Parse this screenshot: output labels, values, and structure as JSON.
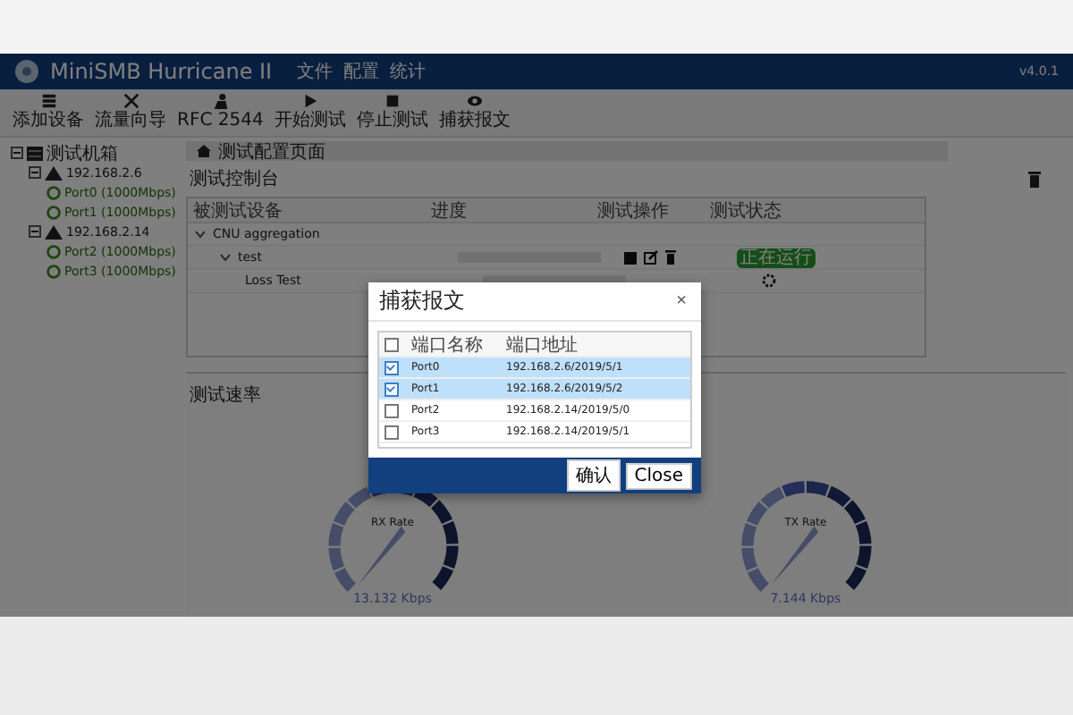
{
  "app": {
    "title": "MiniSMB Hurricane II",
    "version": "v4.0.1"
  },
  "menu": [
    "文件",
    "配置",
    "统计"
  ],
  "toolbar": [
    {
      "label": "添加设备",
      "kind": "add"
    },
    {
      "label": "流量向导",
      "kind": "wizard"
    },
    {
      "label": "RFC 2544",
      "kind": "rfc"
    },
    {
      "label": "开始测试",
      "kind": "start"
    },
    {
      "label": "停止测试",
      "kind": "stop"
    },
    {
      "label": "捕获报文",
      "kind": "capture"
    }
  ],
  "tree": [
    {
      "label": "测试机箱",
      "kind": "chassis",
      "expanded": true,
      "children": [
        {
          "label": "192.168.2.6",
          "kind": "host",
          "expanded": true,
          "children": [
            {
              "label": "Port0 (1000Mbps)",
              "kind": "port"
            },
            {
              "label": "Port1 (1000Mbps)",
              "kind": "port"
            }
          ]
        },
        {
          "label": "192.168.2.14",
          "kind": "host",
          "expanded": true,
          "children": [
            {
              "label": "Port2 (1000Mbps)",
              "kind": "port"
            },
            {
              "label": "Port3 (1000Mbps)",
              "kind": "port"
            }
          ]
        }
      ]
    }
  ],
  "breadcrumb": "测试配置页面",
  "control_panel": {
    "title": "测试控制台",
    "columns": [
      "被测试设备",
      "进度",
      "测试操作",
      "测试状态"
    ],
    "rows": [
      {
        "name": "CNU aggregation",
        "expanded": true,
        "children": [
          {
            "name": "test",
            "expanded": true,
            "level": 0,
            "actions": true,
            "status": "正在运行",
            "children": [
              {
                "name": "Loss Test",
                "level": 0,
                "pending": true
              }
            ]
          }
        ]
      }
    ]
  },
  "speed_panel": {
    "title": "测试速率",
    "gauges": [
      {
        "label": "RX Rate",
        "reading": "13.132 Kbps"
      },
      {
        "label": "TX Rate",
        "reading": "7.144 Kbps"
      }
    ]
  },
  "dialog": {
    "title": "捕获报文",
    "close": "×",
    "header_checked": false,
    "columns": [
      "端口名称",
      "端口地址"
    ],
    "rows": [
      {
        "name": "Port0",
        "address": "192.168.2.6/2019/5/1",
        "checked": true,
        "selected": true
      },
      {
        "name": "Port1",
        "address": "192.168.2.6/2019/5/2",
        "checked": true,
        "selected": true
      },
      {
        "name": "Port2",
        "address": "192.168.2.14/2019/5/0",
        "checked": false,
        "selected": false
      },
      {
        "name": "Port3",
        "address": "192.168.2.14/2019/5/1",
        "checked": false,
        "selected": false
      }
    ],
    "buttons": [
      "确认",
      "Close"
    ]
  }
}
